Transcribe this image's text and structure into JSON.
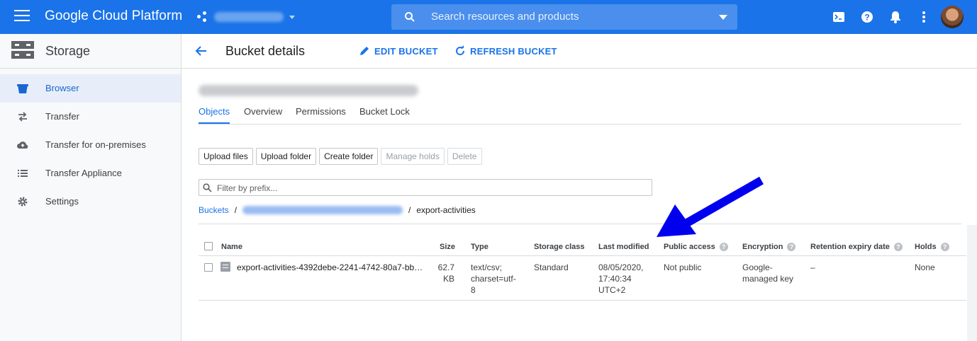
{
  "topbar": {
    "brand": "Google Cloud Platform",
    "search_placeholder": "Search resources and products"
  },
  "leftnav": {
    "title": "Storage",
    "items": [
      {
        "label": "Browser",
        "icon": "bucket-icon",
        "active": true
      },
      {
        "label": "Transfer",
        "icon": "transfer-arrows-icon"
      },
      {
        "label": "Transfer for on-premises",
        "icon": "cloud-upload-icon"
      },
      {
        "label": "Transfer Appliance",
        "icon": "list-icon"
      },
      {
        "label": "Settings",
        "icon": "gear-icon"
      }
    ]
  },
  "header": {
    "title": "Bucket details",
    "edit_label": "EDIT BUCKET",
    "refresh_label": "REFRESH BUCKET"
  },
  "tabs": [
    "Objects",
    "Overview",
    "Permissions",
    "Bucket Lock"
  ],
  "toolbar": {
    "upload_files": "Upload files",
    "upload_folder": "Upload folder",
    "create_folder": "Create folder",
    "manage_holds": "Manage holds",
    "delete": "Delete"
  },
  "filter": {
    "placeholder": "Filter by prefix..."
  },
  "breadcrumb": {
    "root": "Buckets",
    "sep": "/",
    "current": "export-activities"
  },
  "table": {
    "headers": {
      "name": "Name",
      "size": "Size",
      "type": "Type",
      "storage_class": "Storage class",
      "last_modified": "Last modified",
      "public_access": "Public access",
      "encryption": "Encryption",
      "retention": "Retention expiry date",
      "holds": "Holds"
    },
    "rows": [
      {
        "name": "export-activities-4392debe-2241-4742-80a7-bb…",
        "size_1": "62.7",
        "size_2": "KB",
        "type_1": "text/csv;",
        "type_2": "charset=utf-",
        "type_3": "8",
        "storage_class": "Standard",
        "modified_1": "08/05/2020,",
        "modified_2": "17:40:34",
        "modified_3": "UTC+2",
        "public_access": "Not public",
        "encryption_1": "Google-",
        "encryption_2": "managed key",
        "retention": "–",
        "holds": "None"
      }
    ]
  },
  "colors": {
    "brand_blue": "#1a73e8",
    "annotation_arrow": "#0000ee"
  }
}
